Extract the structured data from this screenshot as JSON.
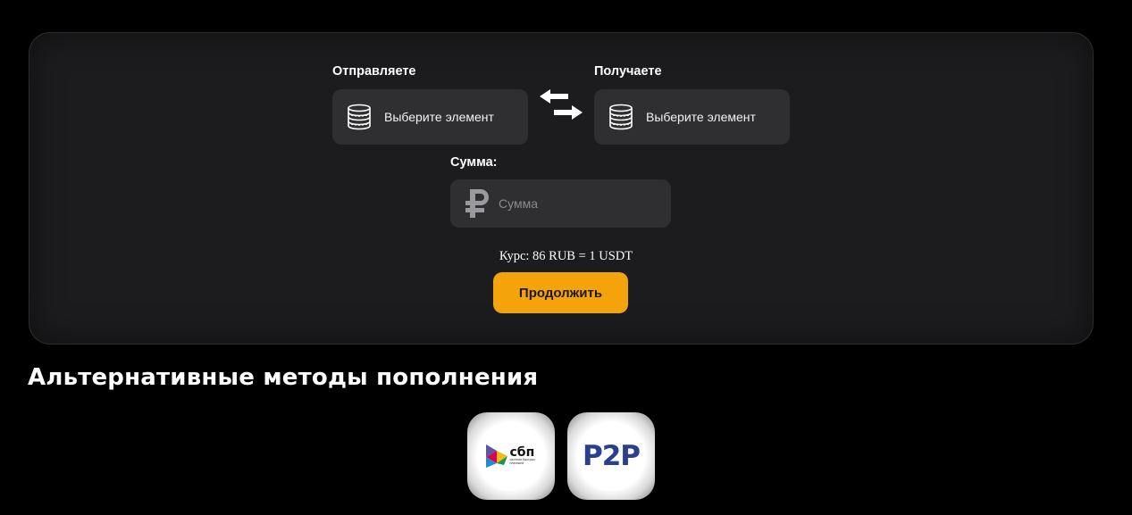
{
  "exchange": {
    "send_label": "Отправляете",
    "receive_label": "Получаете",
    "send_select": {
      "text": "Выберите элемент",
      "icon": "coins-icon"
    },
    "receive_select": {
      "text": "Выберите элемент",
      "icon": "coins-icon"
    },
    "swap_icon": "swap-arrows-icon",
    "amount_label": "Сумма:",
    "amount_placeholder": "Сумма",
    "amount_value": "",
    "currency_icon": "ruble-icon",
    "rate_text": "Курс: 86 RUB = 1 USDT",
    "continue_label": "Продолжить"
  },
  "alternative": {
    "title": "Альтернативные методы пополнения",
    "methods": [
      {
        "logo_text": "сбп",
        "subtitle": "система быстрых платежей",
        "icon": "sbp-logo-icon"
      },
      {
        "logo_text": "P2P",
        "icon": "p2p-logo-icon"
      }
    ]
  },
  "colors": {
    "background": "#000000",
    "card": "#1c1c1e",
    "field": "#2f2f31",
    "accent": "#f4a30a",
    "p2p_blue": "#2a3f8f"
  }
}
